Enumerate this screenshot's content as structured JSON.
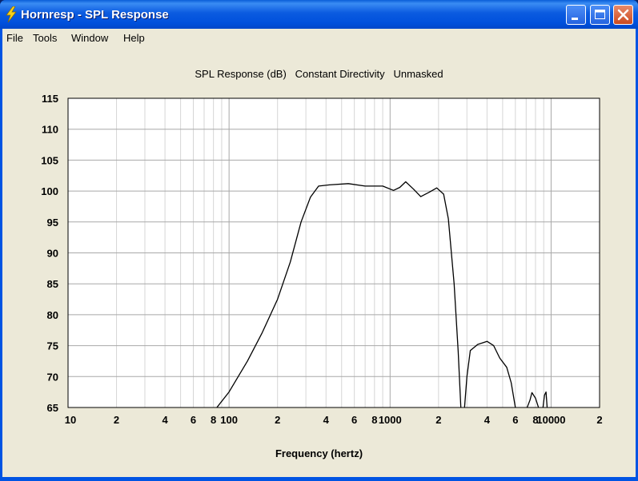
{
  "window": {
    "title": "Hornresp - SPL Response",
    "buttons": {
      "minimize": "minimize",
      "maximize": "maximize",
      "close": "close"
    }
  },
  "menu": [
    "File",
    "Tools",
    "Window",
    "Help"
  ],
  "chart_data": {
    "type": "line",
    "title": "SPL Response (dB)   Constant Directivity   Unmasked",
    "xlabel": "Frequency (hertz)",
    "ylabel": "",
    "xscale": "log",
    "xlim": [
      10,
      20000
    ],
    "ylim": [
      65,
      115
    ],
    "grid": true,
    "yticks": [
      115,
      110,
      105,
      100,
      95,
      90,
      85,
      80,
      75,
      70,
      65
    ],
    "xtick_labels": [
      {
        "x": 10,
        "label": "10"
      },
      {
        "x": 20,
        "label": "2"
      },
      {
        "x": 40,
        "label": "4"
      },
      {
        "x": 60,
        "label": "6"
      },
      {
        "x": 80,
        "label": "8"
      },
      {
        "x": 100,
        "label": "100"
      },
      {
        "x": 200,
        "label": "2"
      },
      {
        "x": 400,
        "label": "4"
      },
      {
        "x": 600,
        "label": "6"
      },
      {
        "x": 800,
        "label": "8"
      },
      {
        "x": 1000,
        "label": "1000"
      },
      {
        "x": 2000,
        "label": "2"
      },
      {
        "x": 4000,
        "label": "4"
      },
      {
        "x": 6000,
        "label": "6"
      },
      {
        "x": 8000,
        "label": "8"
      },
      {
        "x": 10000,
        "label": "10000"
      },
      {
        "x": 20000,
        "label": "2"
      }
    ],
    "series": [
      {
        "segments": [
          [
            [
              84,
              65
            ],
            [
              100,
              67.5
            ],
            [
              130,
              72.5
            ],
            [
              160,
              77
            ],
            [
              200,
              82.5
            ],
            [
              240,
              88.5
            ],
            [
              280,
              95
            ],
            [
              320,
              99
            ],
            [
              360,
              100.8
            ],
            [
              420,
              101
            ],
            [
              550,
              101.2
            ],
            [
              700,
              100.8
            ],
            [
              900,
              100.8
            ],
            [
              1050,
              100.1
            ],
            [
              1150,
              100.6
            ],
            [
              1250,
              101.5
            ],
            [
              1400,
              100.3
            ],
            [
              1550,
              99.1
            ],
            [
              1750,
              99.8
            ],
            [
              1950,
              100.5
            ],
            [
              2150,
              99.5
            ],
            [
              2300,
              95.5
            ],
            [
              2500,
              85
            ],
            [
              2650,
              74
            ],
            [
              2750,
              65
            ]
          ],
          [
            [
              2900,
              65
            ],
            [
              3000,
              70
            ],
            [
              3150,
              74.2
            ],
            [
              3500,
              75.2
            ],
            [
              4000,
              75.7
            ],
            [
              4400,
              75
            ],
            [
              4800,
              73
            ],
            [
              5300,
              71.5
            ],
            [
              5650,
              69
            ],
            [
              6000,
              65
            ]
          ],
          [
            [
              7100,
              65
            ],
            [
              7400,
              66.2
            ],
            [
              7600,
              67.4
            ],
            [
              8000,
              66.5
            ],
            [
              8350,
              65
            ]
          ],
          [
            [
              8900,
              65
            ],
            [
              9100,
              67
            ],
            [
              9300,
              67.5
            ],
            [
              9450,
              65
            ]
          ]
        ]
      }
    ]
  }
}
